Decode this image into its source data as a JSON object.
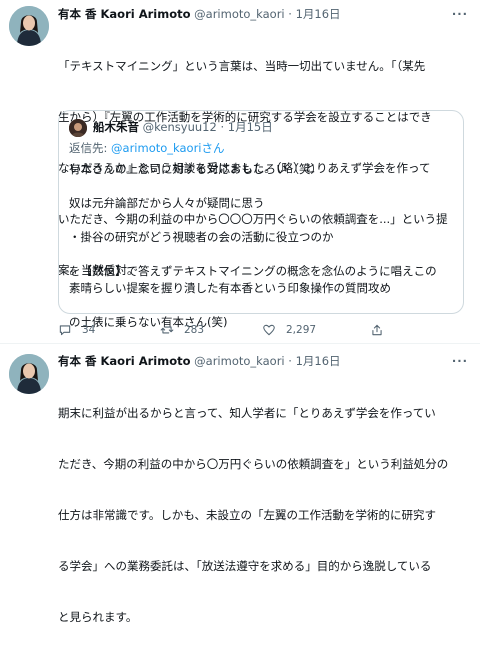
{
  "tweet1": {
    "name": "有本 香 Kaori Arimoto",
    "handle": "@arimoto_kaori",
    "dot": "·",
    "time": "1月16日",
    "more_label": "···",
    "lines": [
      "「テキストマイニング」という言葉は、当時一切出ていません。「（某先",
      "生から）『左翼の工作活動を学術的に研究する学会を設立することはでき",
      "ないだろうか』という相談を受けました。（略）とりあえず学会を作って",
      "いただき、今期の利益の中から〇〇〇万円ぐらいの依頼調査を...」という提",
      "案。当然反対。"
    ],
    "quote": {
      "name": "船木朱音",
      "handle": "@kensyuu12",
      "dot": "·",
      "time": "1月15日",
      "reply_prefix": "返信先:",
      "reply_to": "@arimoto_kaori",
      "reply_suffix": "さん",
      "paragraphs": [
        [
          "有本さんの上念司に対する対応おもしろい（笑）"
        ],
        [
          "奴は元弁論部だから人々が疑問に思う"
        ],
        [
          "・掛谷の研究がどう視聴者の会の活動に役立つのか"
        ],
        [
          "を【数値】で答えずテキストマイニングの概念を念仏のように唱えこの",
          "素晴らしい提案を握り潰した有本香という印象操作の質問攻め"
        ],
        [
          "の土俵に乗らない有本さん(笑)"
        ]
      ]
    },
    "actions": {
      "replies": "34",
      "retweets": "283",
      "likes": "2,297"
    }
  },
  "tweet2": {
    "name": "有本 香 Kaori Arimoto",
    "handle": "@arimoto_kaori",
    "dot": "·",
    "time": "1月16日",
    "more_label": "···",
    "lines": [
      "期末に利益が出るからと言って、知人学者に「とりあえず学会を作ってい",
      "ただき、今期の利益の中から〇万円ぐらいの依頼調査を」という利益処分の",
      "仕方は非常識です。しかも、未設立の「左翼の工作活動を学術的に研究す",
      "る学会」への業務委託は、「放送法遵守を求める」目的から逸脱している",
      "と見られます。"
    ]
  },
  "colors": {
    "accent": "#1d9bf0",
    "muted": "#536471",
    "text": "#0f1419",
    "border": "#cfd9de"
  },
  "icons": {
    "reply": "speech-bubble-icon",
    "retweet": "retweet-arrows-icon",
    "like": "heart-icon",
    "share": "share-upload-icon",
    "more": "more-dots-icon"
  }
}
